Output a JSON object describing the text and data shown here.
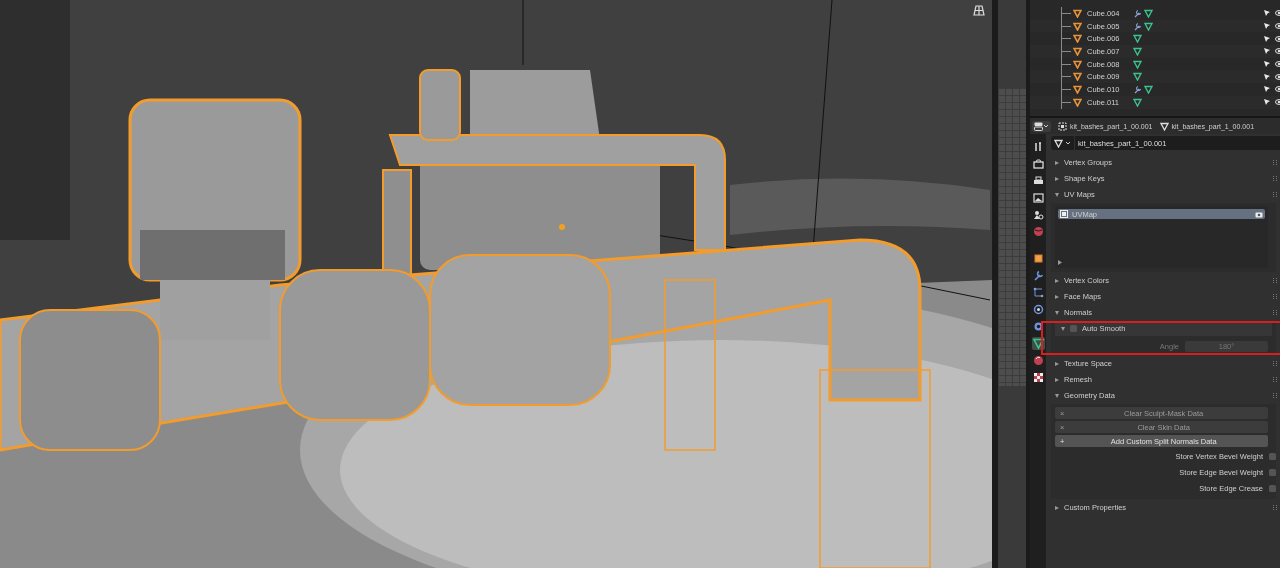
{
  "outliner": {
    "rows": [
      {
        "name": "Cube.004",
        "modifier": true
      },
      {
        "name": "Cube.005",
        "modifier": true
      },
      {
        "name": "Cube.006",
        "modifier": false
      },
      {
        "name": "Cube.007",
        "modifier": false
      },
      {
        "name": "Cube.008",
        "modifier": false
      },
      {
        "name": "Cube.009",
        "modifier": false
      },
      {
        "name": "Cube.010",
        "modifier": true
      },
      {
        "name": "Cube.011",
        "modifier": false
      }
    ]
  },
  "properties": {
    "breadcrumbs": [
      "kit_bashes_part_1_00.001",
      "kit_bashes_part_1_00.001"
    ],
    "mesh_name": "kit_bashes_part_1_00.001",
    "tabs": [
      {
        "selected": false
      },
      {
        "selected": false
      },
      {
        "selected": false
      },
      {
        "selected": false
      },
      {
        "selected": false
      },
      {
        "selected": false
      },
      {
        "selected": false
      },
      {
        "selected": false
      },
      {
        "selected": false
      },
      {
        "selected": false
      },
      {
        "selected": false
      },
      {
        "selected": true
      },
      {
        "selected": false
      },
      {
        "selected": false
      }
    ],
    "panels": [
      {
        "kind": "panel",
        "title": "Vertex Groups",
        "expanded": false
      },
      {
        "kind": "panel",
        "title": "Shape Keys",
        "expanded": false
      },
      {
        "kind": "uv_list",
        "title": "UV Maps",
        "expanded": true,
        "items": [
          {
            "name": "UVMap",
            "selected": true
          }
        ]
      },
      {
        "kind": "panel",
        "title": "Vertex Colors",
        "expanded": false
      },
      {
        "kind": "panel",
        "title": "Face Maps",
        "expanded": false
      },
      {
        "kind": "normals",
        "title": "Normals",
        "expanded": true,
        "subpanel": {
          "title": "Auto Smooth",
          "expanded": true,
          "checked": false,
          "angle_label": "Angle",
          "angle_value": "180°",
          "disabled": true
        }
      },
      {
        "kind": "panel",
        "title": "Texture Space",
        "expanded": false
      },
      {
        "kind": "panel",
        "title": "Remesh",
        "expanded": false
      },
      {
        "kind": "geometry",
        "title": "Geometry Data",
        "expanded": true,
        "buttons": [
          {
            "icon": "×",
            "label": "Clear Sculpt-Mask Data",
            "disabled": true
          },
          {
            "icon": "×",
            "label": "Clear Skin Data",
            "disabled": true
          },
          {
            "icon": "+",
            "label": "Add Custom Split Normals Data",
            "disabled": false
          }
        ],
        "checkboxes": [
          {
            "label": "Store Vertex Bevel Weight",
            "checked": false
          },
          {
            "label": "Store Edge Bevel Weight",
            "checked": false
          },
          {
            "label": "Store Edge Crease",
            "checked": false
          }
        ]
      },
      {
        "kind": "panel",
        "title": "Custom Properties",
        "expanded": false
      }
    ]
  }
}
